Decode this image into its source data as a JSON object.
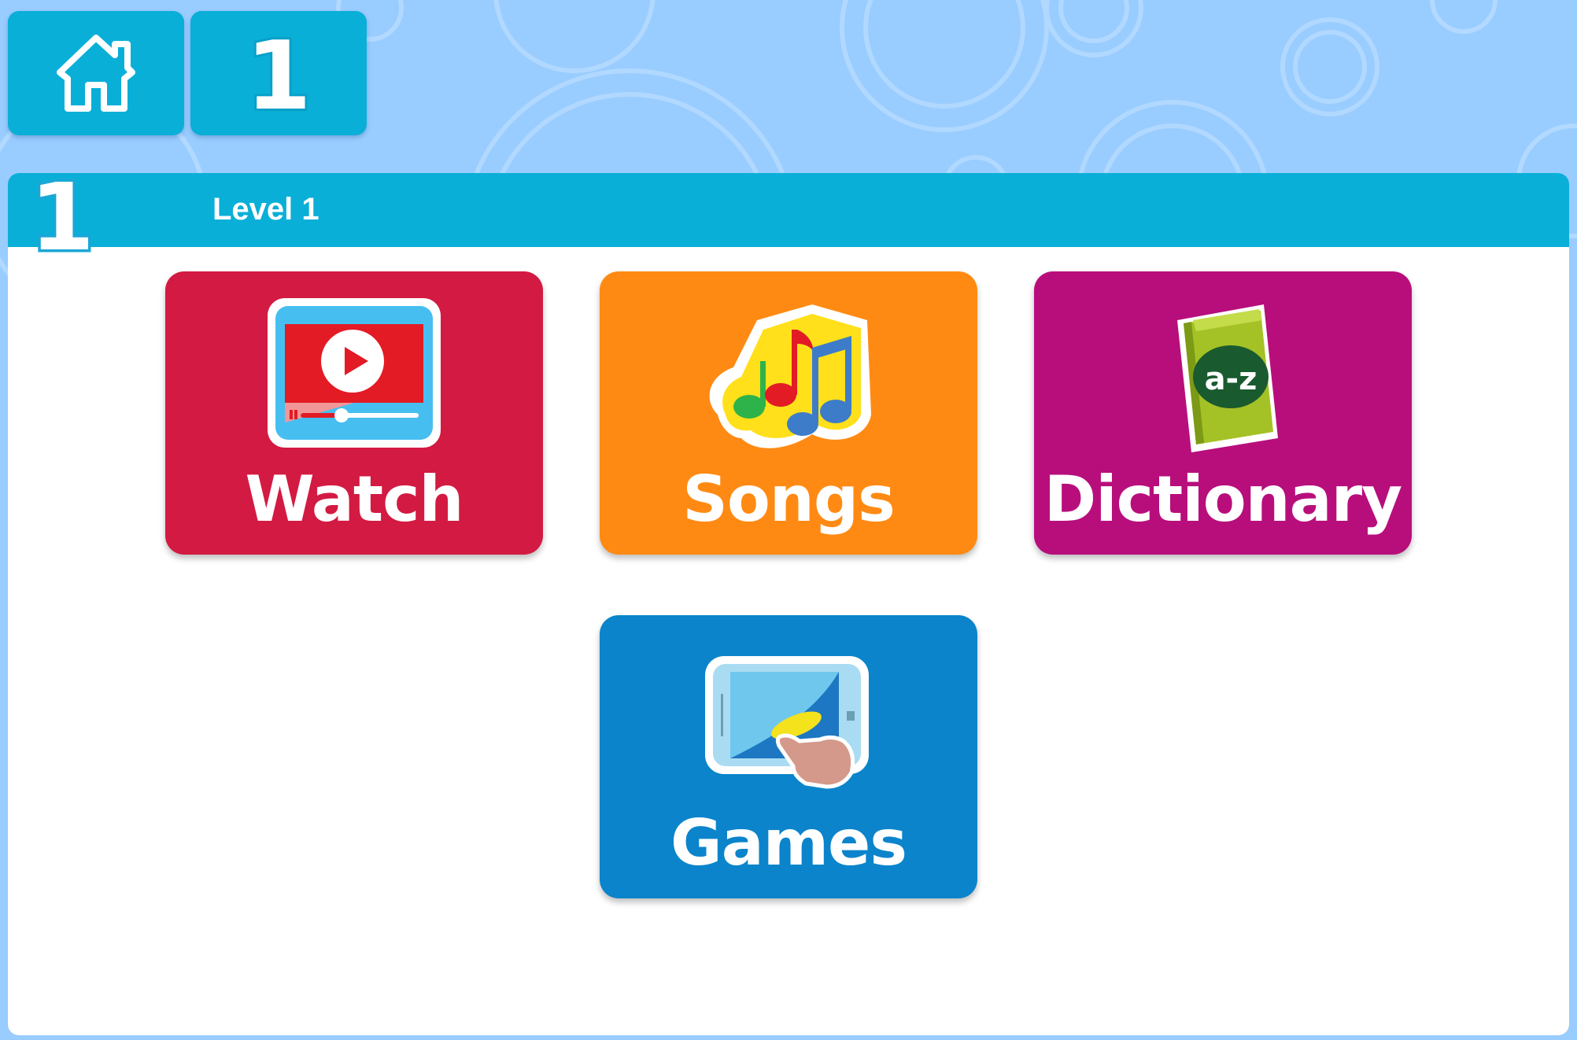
{
  "nav": {
    "home_icon": "home-icon",
    "level_badge": "1"
  },
  "header": {
    "badge": "1",
    "title": "Level 1"
  },
  "tiles": [
    {
      "label": "Watch",
      "icon": "video-player-icon",
      "color": "#d31a42"
    },
    {
      "label": "Songs",
      "icon": "music-notes-icon",
      "color": "#ff8a13"
    },
    {
      "label": "Dictionary",
      "icon": "book-icon",
      "color": "#b80e7c",
      "icon_text": "a-z"
    },
    {
      "label": "Games",
      "icon": "tablet-touch-icon",
      "color": "#0b84cb"
    }
  ],
  "colors": {
    "background": "#99ccff",
    "accent": "#0aafd8",
    "panel": "#ffffff"
  }
}
